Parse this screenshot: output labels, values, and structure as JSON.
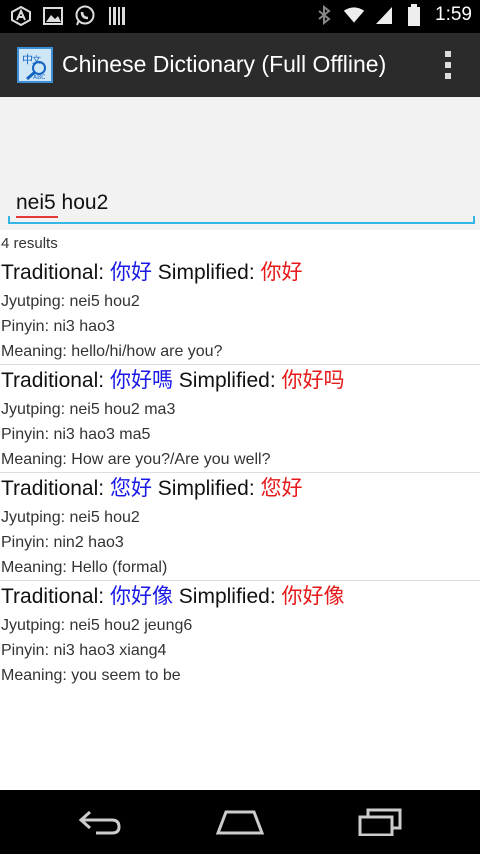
{
  "status_bar": {
    "time": "1:59",
    "icons_left": [
      "accessibility-icon",
      "gallery-icon",
      "whatsapp-icon",
      "barcode-icon"
    ],
    "icons_right": [
      "bluetooth-icon",
      "wifi-icon",
      "signal-icon",
      "battery-icon"
    ]
  },
  "action_bar": {
    "title": "Chinese Dictionary (Full Offline)",
    "icon": "dictionary-app-icon",
    "overflow_icon": "overflow-menu-icon"
  },
  "search": {
    "value": "nei5 hou2",
    "placeholder": ""
  },
  "results": {
    "count_text": "4 results",
    "trad_label": "Traditional:",
    "simp_label": "Simplified:",
    "items": [
      {
        "traditional": "你好",
        "simplified": "你好",
        "jyutping": "Jyutping: nei5 hou2",
        "pinyin": "Pinyin: ni3 hao3",
        "meaning": "Meaning: hello/hi/how are you?"
      },
      {
        "traditional": "你好嗎",
        "simplified": "你好吗",
        "jyutping": "Jyutping: nei5 hou2 ma3",
        "pinyin": "Pinyin: ni3 hao3 ma5",
        "meaning": "Meaning: How are you?/Are you well?"
      },
      {
        "traditional": "您好",
        "simplified": "您好",
        "jyutping": "Jyutping: nei5 hou2",
        "pinyin": "Pinyin: nin2 hao3",
        "meaning": "Meaning: Hello (formal)"
      },
      {
        "traditional": "你好像",
        "simplified": "你好像",
        "jyutping": "Jyutping: nei5 hou2 jeung6",
        "pinyin": "Pinyin: ni3 hao3 xiang4",
        "meaning": "Meaning: you seem to be"
      }
    ]
  },
  "nav_bar": {
    "back_icon": "back-icon",
    "home_icon": "home-icon",
    "recents_icon": "recents-icon"
  },
  "colors": {
    "traditional": "#1a1ae6",
    "simplified": "#e61a1a",
    "accent": "#33b5e5",
    "action_bar": "#2b2b2b"
  }
}
